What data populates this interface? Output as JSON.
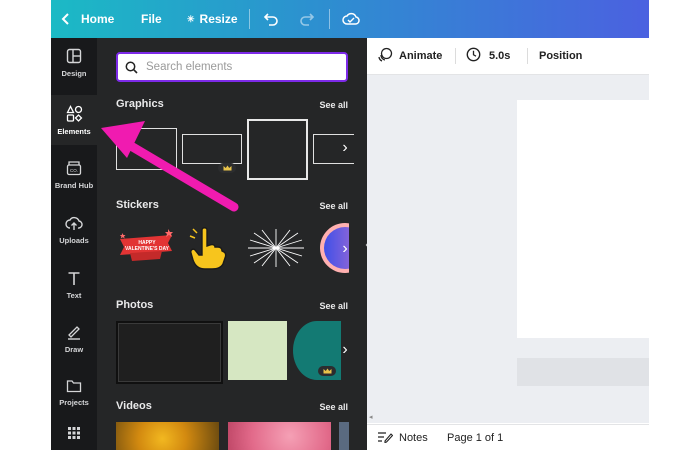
{
  "topbar": {
    "home_label": "Home",
    "file_label": "File",
    "resize_label": "Resize",
    "icons": [
      "chevron-left-icon",
      "sparkle-icon",
      "undo-icon",
      "redo-icon",
      "cloud-saved-icon"
    ]
  },
  "rail": {
    "items": [
      {
        "label": "Design",
        "icon": "layout-icon"
      },
      {
        "label": "Elements",
        "icon": "shapes-icon"
      },
      {
        "label": "Brand Hub",
        "icon": "brand-kit-icon"
      },
      {
        "label": "Uploads",
        "icon": "cloud-upload-icon"
      },
      {
        "label": "Text",
        "icon": "text-icon"
      },
      {
        "label": "Draw",
        "icon": "pen-icon"
      },
      {
        "label": "Projects",
        "icon": "folder-icon"
      },
      {
        "label": "",
        "icon": "apps-grid-icon"
      }
    ],
    "active": "Elements"
  },
  "panel": {
    "search_placeholder": "Search elements",
    "sections": {
      "graphics": {
        "title": "Graphics",
        "see_all": "See all"
      },
      "stickers": {
        "title": "Stickers",
        "see_all": "See all",
        "sticker_text": "HAPPY VALENTINE'S DAY"
      },
      "photos": {
        "title": "Photos",
        "see_all": "See all"
      },
      "videos": {
        "title": "Videos",
        "see_all": "See all"
      }
    }
  },
  "canvas": {
    "animate_label": "Animate",
    "duration_label": "5.0s",
    "position_label": "Position",
    "notes_label": "Notes",
    "page_label": "Page 1 of 1"
  },
  "colors": {
    "accent": "#7d2ae8",
    "annotation_arrow": "#f01bb0",
    "panel_bg": "#252627",
    "rail_bg": "#18191b"
  }
}
